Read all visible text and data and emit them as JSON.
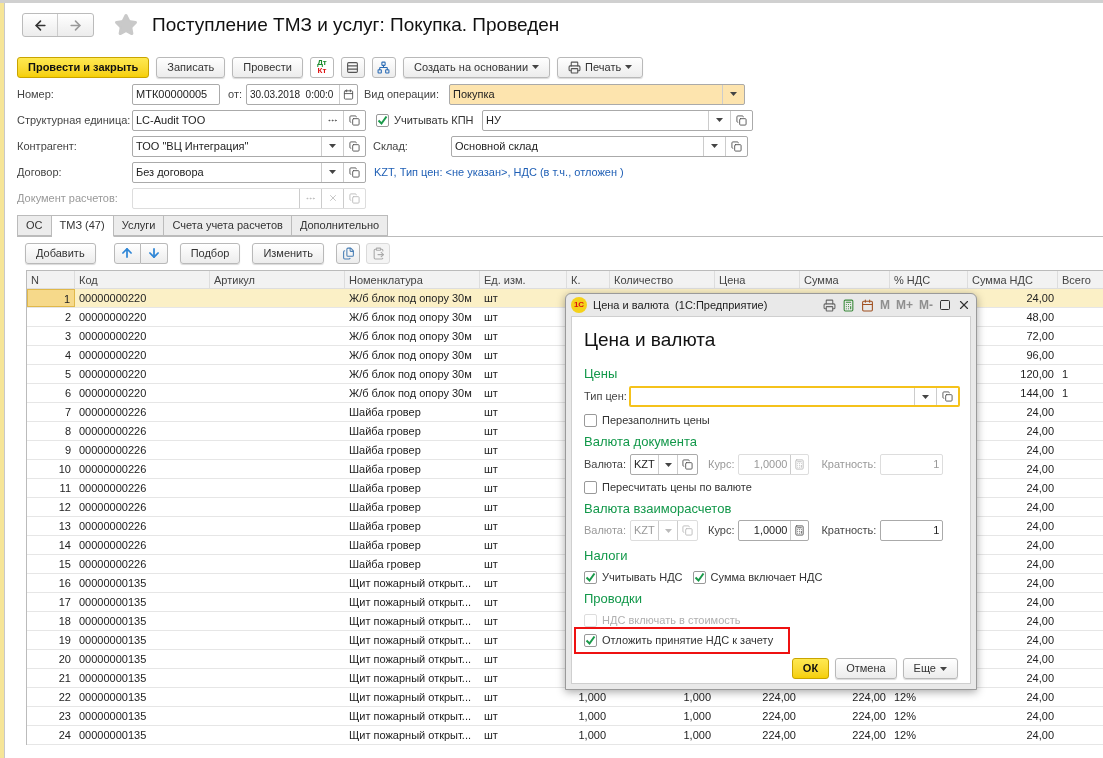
{
  "window": {
    "title": "Поступление ТМЗ и услуг: Покупка. Проведен",
    "favorite": false
  },
  "toolbar": {
    "buttons": [
      {
        "kind": "primary",
        "label": "Провести и закрыть"
      },
      {
        "kind": "plain",
        "label": "Записать"
      },
      {
        "kind": "plain",
        "label": "Провести"
      },
      {
        "kind": "dtkt",
        "top": "Дт",
        "bottom": "Кт"
      },
      {
        "kind": "list"
      },
      {
        "kind": "structure"
      },
      {
        "kind": "menu",
        "label": "Создать на основании"
      },
      {
        "kind": "print",
        "label": "Печать"
      }
    ]
  },
  "form": {
    "number": {
      "label": "Номер:",
      "value": "МТК00000005"
    },
    "date": {
      "label": "от:",
      "value": "30.03.2018  0:00:0"
    },
    "operation": {
      "label": "Вид операции:",
      "value": "Покупка"
    },
    "unit": {
      "label": "Структурная единица:",
      "value": "LC-Audit ТОО"
    },
    "kpn": {
      "label": "Учитывать КПН",
      "checked": true,
      "value": "НУ"
    },
    "counterparty": {
      "label": "Контрагент:",
      "value": "ТОО \"ВЦ Интеграция\""
    },
    "warehouse": {
      "label": "Склад:",
      "value": "Основной склад"
    },
    "contract": {
      "label": "Договор:",
      "value": "Без договора"
    },
    "price_link": "KZT, Тип цен: <не указан>, НДС (в т.ч., отложен )",
    "payment_document": {
      "label": "Документ расчетов:",
      "disabled": true
    }
  },
  "tabs": [
    {
      "label": "ОС",
      "selected": false
    },
    {
      "label": "ТМЗ (47)",
      "selected": true
    },
    {
      "label": "Услуги",
      "selected": false
    },
    {
      "label": "Счета учета расчетов",
      "selected": false
    },
    {
      "label": "Дополнительно",
      "selected": false
    }
  ],
  "table_toolbar": [
    {
      "kind": "text",
      "label": "Добавить"
    },
    {
      "kind": "up"
    },
    {
      "kind": "down"
    },
    {
      "kind": "text",
      "label": "Подбор"
    },
    {
      "kind": "text",
      "label": "Изменить"
    },
    {
      "kind": "copy",
      "disabled": false
    },
    {
      "kind": "paste",
      "disabled": true
    }
  ],
  "table": {
    "columns": [
      "N",
      "Код",
      "Артикул",
      "Номенклатура",
      "Ед. изм.",
      "К.",
      "Количество",
      "Цена",
      "Сумма",
      "% НДС",
      "Сумма НДС",
      "Всего"
    ],
    "rows": [
      {
        "selected": true,
        "n": "1",
        "code": "00000000220",
        "name": "Ж/б блок под опору 30м",
        "unit": "шт",
        "vat_sum": "24,00"
      },
      {
        "selected": false,
        "n": "2",
        "code": "00000000220",
        "name": "Ж/б блок под опору 30м",
        "unit": "шт",
        "vat_sum": "48,00"
      },
      {
        "selected": false,
        "n": "3",
        "code": "00000000220",
        "name": "Ж/б блок под опору 30м",
        "unit": "шт",
        "vat_sum": "72,00"
      },
      {
        "selected": false,
        "n": "4",
        "code": "00000000220",
        "name": "Ж/б блок под опору 30м",
        "unit": "шт",
        "vat_sum": "96,00"
      },
      {
        "selected": false,
        "n": "5",
        "code": "00000000220",
        "name": "Ж/б блок под опору 30м",
        "unit": "шт",
        "vat_sum": "120,00",
        "total": "1"
      },
      {
        "selected": false,
        "n": "6",
        "code": "00000000220",
        "name": "Ж/б блок под опору 30м",
        "unit": "шт",
        "vat_sum": "144,00",
        "total": "1"
      },
      {
        "selected": false,
        "n": "7",
        "code": "00000000226",
        "name": "Шайба гровер",
        "unit": "шт",
        "vat_sum": "24,00"
      },
      {
        "selected": false,
        "n": "8",
        "code": "00000000226",
        "name": "Шайба гровер",
        "unit": "шт",
        "vat_sum": "24,00"
      },
      {
        "selected": false,
        "n": "9",
        "code": "00000000226",
        "name": "Шайба гровер",
        "unit": "шт",
        "vat_sum": "24,00"
      },
      {
        "selected": false,
        "n": "10",
        "code": "00000000226",
        "name": "Шайба гровер",
        "unit": "шт",
        "vat_sum": "24,00"
      },
      {
        "selected": false,
        "n": "11",
        "code": "00000000226",
        "name": "Шайба гровер",
        "unit": "шт",
        "vat_sum": "24,00"
      },
      {
        "selected": false,
        "n": "12",
        "code": "00000000226",
        "name": "Шайба гровер",
        "unit": "шт",
        "vat_sum": "24,00"
      },
      {
        "selected": false,
        "n": "13",
        "code": "00000000226",
        "name": "Шайба гровер",
        "unit": "шт",
        "vat_sum": "24,00"
      },
      {
        "selected": false,
        "n": "14",
        "code": "00000000226",
        "name": "Шайба гровер",
        "unit": "шт",
        "vat_sum": "24,00"
      },
      {
        "selected": false,
        "n": "15",
        "code": "00000000226",
        "name": "Шайба гровер",
        "unit": "шт",
        "vat_sum": "24,00"
      },
      {
        "selected": false,
        "n": "16",
        "code": "00000000135",
        "name": "Щит пожарный открыт...",
        "unit": "шт",
        "vat_sum": "24,00"
      },
      {
        "selected": false,
        "n": "17",
        "code": "00000000135",
        "name": "Щит пожарный открыт...",
        "unit": "шт",
        "vat_sum": "24,00"
      },
      {
        "selected": false,
        "n": "18",
        "code": "00000000135",
        "name": "Щит пожарный открыт...",
        "unit": "шт",
        "vat_sum": "24,00"
      },
      {
        "selected": false,
        "n": "19",
        "code": "00000000135",
        "name": "Щит пожарный открыт...",
        "unit": "шт",
        "vat_sum": "24,00"
      },
      {
        "selected": false,
        "n": "20",
        "code": "00000000135",
        "name": "Щит пожарный открыт...",
        "unit": "шт",
        "vat_sum": "24,00"
      },
      {
        "selected": false,
        "n": "21",
        "code": "00000000135",
        "name": "Щит пожарный открыт...",
        "unit": "шт",
        "vat_sum": "24,00"
      },
      {
        "selected": false,
        "n": "22",
        "code": "00000000135",
        "name": "Щит пожарный открыт...",
        "unit": "шт",
        "k": "1,000",
        "qty": "1,000",
        "price": "224,00",
        "sum": "224,00",
        "vat_rate": "12%",
        "vat_sum": "24,00"
      },
      {
        "selected": false,
        "n": "23",
        "code": "00000000135",
        "name": "Щит пожарный открыт...",
        "unit": "шт",
        "k": "1,000",
        "qty": "1,000",
        "price": "224,00",
        "sum": "224,00",
        "vat_rate": "12%",
        "vat_sum": "24,00"
      },
      {
        "selected": false,
        "n": "24",
        "code": "00000000135",
        "name": "Щит пожарный открыт...",
        "unit": "шт",
        "k": "1,000",
        "qty": "1,000",
        "price": "224,00",
        "sum": "224,00",
        "vat_rate": "12%",
        "vat_sum": "24,00"
      }
    ]
  },
  "dialog": {
    "title": "Цена и валюта  (1С:Предприятие)",
    "logo": "1С",
    "memory_buttons": [
      "M",
      "M+",
      "M-"
    ],
    "heading": "Цена и валюта",
    "prices": {
      "heading": "Цены",
      "price_type": {
        "label": "Тип цен:"
      },
      "refill": {
        "label": "Перезаполнить цены",
        "checked": false
      }
    },
    "doc_currency": {
      "heading": "Валюта документа",
      "currency": {
        "label": "Валюта:",
        "value": "KZT",
        "disabled": false
      },
      "rate": {
        "label": "Курс:",
        "value": "1,0000",
        "disabled": true
      },
      "multiplicity": {
        "label": "Кратность:",
        "value": "1",
        "disabled": true
      },
      "recalc": {
        "label": "Пересчитать цены по валюте",
        "checked": false
      }
    },
    "settlement_currency": {
      "heading": "Валюта взаиморасчетов",
      "currency": {
        "label": "Валюта:",
        "value": "KZT",
        "disabled": true
      },
      "rate": {
        "label": "Курс:",
        "value": "1,0000",
        "disabled": false
      },
      "multiplicity": {
        "label": "Кратность:",
        "value": "1",
        "disabled": false
      }
    },
    "taxes": {
      "heading": "Налоги",
      "items": [
        {
          "label": "Учитывать НДС",
          "checked": true
        },
        {
          "label": "Сумма включает НДС",
          "checked": true
        }
      ]
    },
    "postings": {
      "heading": "Проводки",
      "items": [
        {
          "label": "НДС включать в стоимость",
          "checked": false,
          "disabled": true,
          "highlighted": false
        },
        {
          "label": "Отложить принятие НДС к зачету",
          "checked": true,
          "disabled": false,
          "highlighted": true
        }
      ]
    },
    "buttons": [
      {
        "kind": "default",
        "label": "ОК"
      },
      {
        "kind": "plain",
        "label": "Отмена"
      },
      {
        "kind": "menu",
        "label": "Еще"
      }
    ]
  }
}
